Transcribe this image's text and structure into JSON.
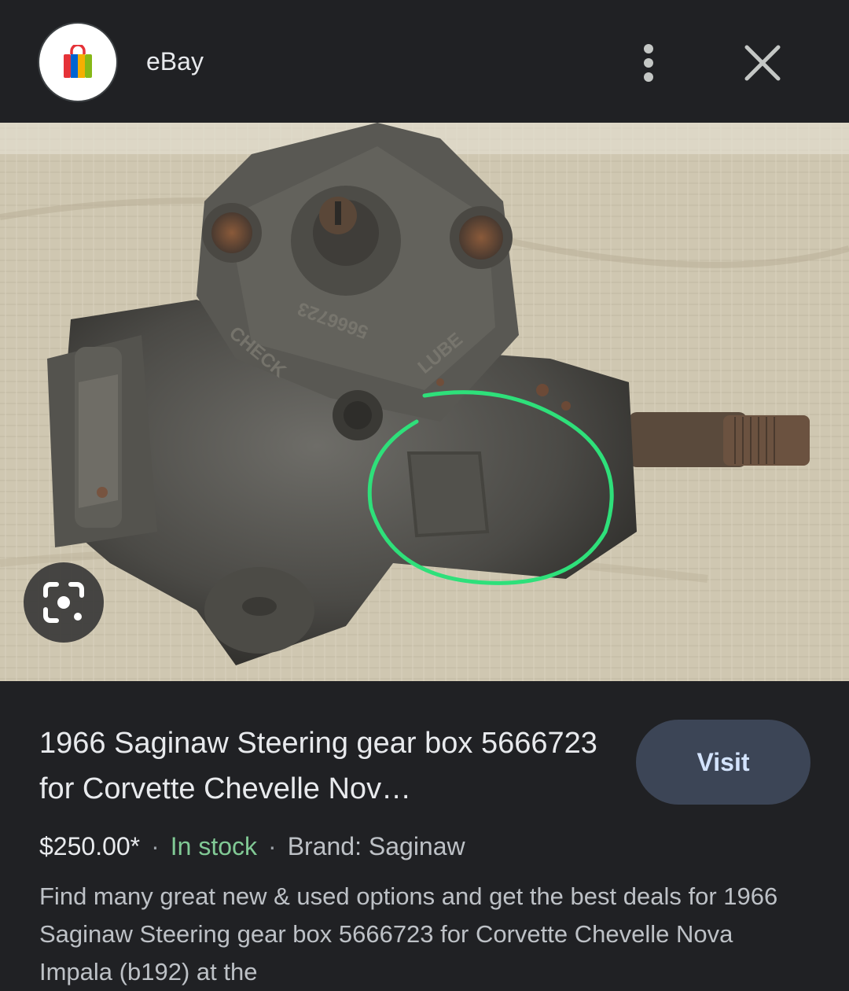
{
  "header": {
    "site_name": "eBay",
    "icon": "shopping-bag-icon",
    "menu_icon": "more-vert-icon",
    "close_icon": "close-icon"
  },
  "image": {
    "alt": "Saginaw steering gear box with green circle marking",
    "lens_icon": "google-lens-icon"
  },
  "result": {
    "title": "1966 Saginaw Steering gear box 5666723 for Corvette Chevelle Nov…",
    "visit_label": "Visit",
    "price": "$250.00*",
    "separator": "·",
    "stock": "In stock",
    "brand": "Brand: Saginaw",
    "description": "Find many great new & used options and get the best deals for 1966 Saginaw Steering gear box 5666723 for Corvette Chevelle Nova Impala (b192) at the"
  },
  "colors": {
    "background": "#202124",
    "stock_green": "#81c995",
    "visit_bg": "#3c4556",
    "marker_green": "#2ee07a"
  }
}
